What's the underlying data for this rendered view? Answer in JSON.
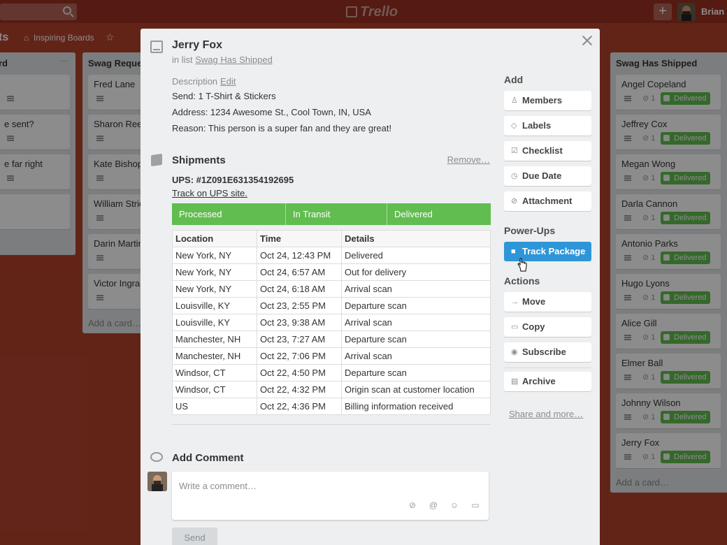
{
  "topbar": {
    "logo": "Trello",
    "user_name": "Brian C"
  },
  "board": {
    "title_fragment": "ts",
    "team_button": "Inspiring Boards"
  },
  "lists": [
    {
      "title": "rd",
      "cards": [
        "",
        "e sent?",
        "e far right",
        ""
      ],
      "add_card": ""
    },
    {
      "title": "Swag Requests",
      "cards": [
        "Fred Lane",
        "Sharon Reese",
        "Kate Bishop",
        "William Strickland",
        "Darin Martin",
        "Victor Ingram"
      ],
      "add_card": "Add a card…"
    },
    {
      "title": "Swag Has Shipped",
      "cards": [
        "Angel Copeland",
        "Jeffrey Cox",
        "Megan Wong",
        "Darla Cannon",
        "Antonio Parks",
        "Hugo Lyons",
        "Alice Gill",
        "Elmer Ball",
        "Johnny Wilson",
        "Jerry Fox"
      ],
      "attachment_count": "1",
      "badge": "Delivered",
      "add_card": "Add a card…"
    }
  ],
  "modal": {
    "title": "Jerry Fox",
    "in_list_prefix": "in list",
    "in_list_name": "Swag Has Shipped",
    "description_label": "Description",
    "edit_label": "Edit",
    "description_lines": [
      "Send: 1 T-Shirt & Stickers",
      "Address: 1234 Awesome St., Cool Town, IN, USA",
      "Reason: This person is a super fan and they are great!"
    ],
    "shipments": {
      "title": "Shipments",
      "remove_label": "Remove…",
      "tracking": "UPS: #1Z091E631354192695",
      "track_link": "Track on UPS site.",
      "status_steps": [
        "Processed",
        "In Transit",
        "Delivered"
      ],
      "columns": [
        "Location",
        "Time",
        "Details"
      ],
      "rows": [
        [
          "New York, NY",
          "Oct 24, 12:43 PM",
          "Delivered"
        ],
        [
          "New York, NY",
          "Oct 24, 6:57 AM",
          "Out for delivery"
        ],
        [
          "New York, NY",
          "Oct 24, 6:18 AM",
          "Arrival scan"
        ],
        [
          "Louisville, KY",
          "Oct 23, 2:55 PM",
          "Departure scan"
        ],
        [
          "Louisville, KY",
          "Oct 23, 9:38 AM",
          "Arrival scan"
        ],
        [
          "Manchester, NH",
          "Oct 23, 7:27 AM",
          "Departure scan"
        ],
        [
          "Manchester, NH",
          "Oct 22, 7:06 PM",
          "Arrival scan"
        ],
        [
          "Windsor, CT",
          "Oct 22, 4:50 PM",
          "Departure scan"
        ],
        [
          "Windsor, CT",
          "Oct 22, 4:32 PM",
          "Origin scan at customer location"
        ],
        [
          "US",
          "Oct 22, 4:36 PM",
          "Billing information received"
        ]
      ]
    },
    "comment": {
      "title": "Add Comment",
      "placeholder": "Write a comment…",
      "send_label": "Send"
    },
    "sidebar": {
      "add_heading": "Add",
      "add_buttons": [
        "Members",
        "Labels",
        "Checklist",
        "Due Date",
        "Attachment"
      ],
      "powerups_heading": "Power-Ups",
      "powerup_button": "Track Package",
      "actions_heading": "Actions",
      "action_buttons": [
        "Move",
        "Copy",
        "Subscribe"
      ],
      "archive_label": "Archive",
      "share_label": "Share and more…"
    }
  },
  "colors": {
    "board_bg": "#b5422d",
    "status_green": "#61bd4f",
    "primary_blue": "#2e96d8"
  }
}
